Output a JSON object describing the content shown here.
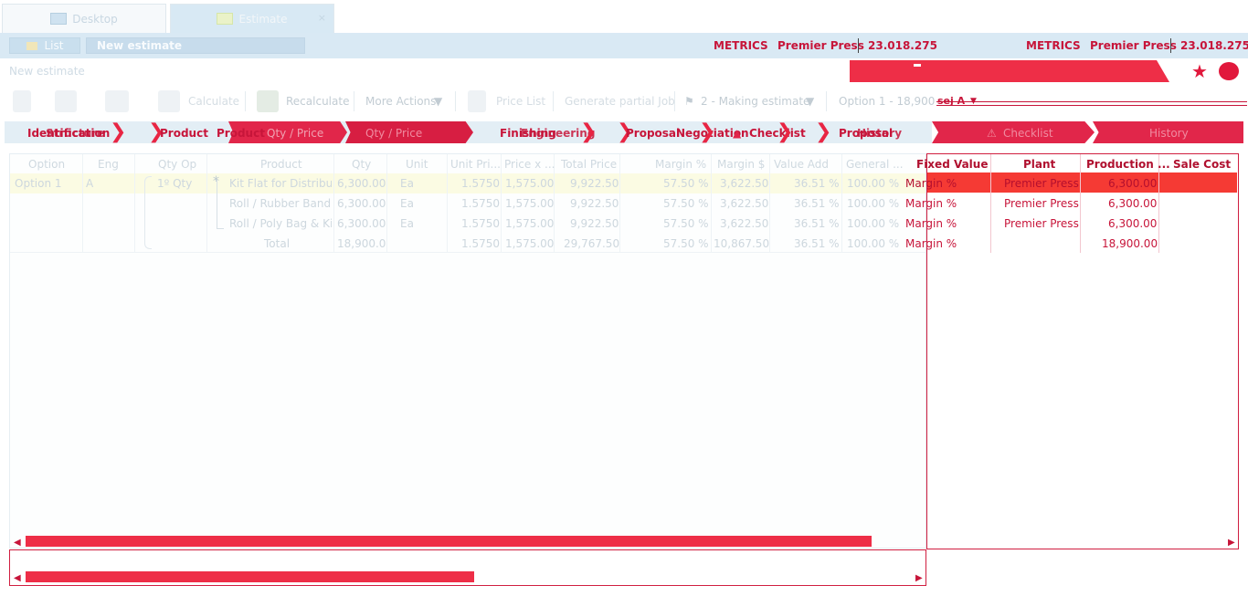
{
  "tabs": {
    "desktop": "Desktop",
    "estimate": "Estimate",
    "close": "×"
  },
  "header": {
    "list_button": "List",
    "title_value": "New estimate",
    "metrics_left": {
      "label": "METRICS",
      "company": "Premier Press",
      "id": "23.018.275"
    },
    "metrics_right": {
      "label": "METRICS",
      "company": "Premier Press",
      "id": "23.018.275"
    }
  },
  "breadcrumb": "New estimate",
  "toolbar": {
    "calculate": "Calculate",
    "recalculate": "Recalculate",
    "more_actions": "More Actions",
    "price_list": "Price List",
    "generate_partial_job": "Generate partial Job",
    "status": "2 - Making estimate",
    "option": "Option 1 - 18,900",
    "option_suffix": "sej A"
  },
  "steps": {
    "identification": "Identification",
    "structure": "Structure",
    "product1": "Product",
    "product2": "Product",
    "qty_price_overlay": "Qty / Price",
    "qty_price_active": "Qty / Price",
    "finishing": "Finishing",
    "engineering": "Engineering",
    "negotiation1": "Negotiation",
    "proposal1": "Proposal",
    "negotiation2": "Negotiation",
    "checklist1": "Checklist",
    "proposal2": "Proposal",
    "history1": "History",
    "checklist2": "Checklist",
    "history2": "History"
  },
  "grid": {
    "columns": [
      "Option",
      "Eng",
      "Qty Op",
      "Product",
      "Qty",
      "Unit",
      "Unit Pri...",
      "Price x ...",
      "Total Price",
      "Margin %",
      "Margin $",
      "Value Add",
      "General ...",
      "Fixed Value",
      "Plant",
      "Production ...",
      "Sale Cost"
    ],
    "rows": [
      {
        "option": "Option 1",
        "eng": "A",
        "qty_op": "1º Qty",
        "product": "Kit Flat for Distribut",
        "qty": "6,300.00",
        "unit": "Ea",
        "unit_price": "1.5750",
        "price_x": "1,575.00",
        "total": "9,922.50",
        "margin_pct": "57.50 %",
        "margin_usd": "3,622.50",
        "value_add": "36.51 %",
        "general": "100.00 %",
        "fixed": "Margin %",
        "plant": "Premier Press",
        "production": "6,300.00"
      },
      {
        "option": "",
        "eng": "",
        "qty_op": "",
        "product": "Roll / Rubber Band",
        "qty": "6,300.00",
        "unit": "Ea",
        "unit_price": "1.5750",
        "price_x": "1,575.00",
        "total": "9,922.50",
        "margin_pct": "57.50 %",
        "margin_usd": "3,622.50",
        "value_add": "36.51 %",
        "general": "100.00 %",
        "fixed": "Margin %",
        "plant": "Premier Press",
        "production": "6,300.00"
      },
      {
        "option": "",
        "eng": "",
        "qty_op": "",
        "product": "Roll / Poly Bag & Kit",
        "qty": "6,300.00",
        "unit": "Ea",
        "unit_price": "1.5750",
        "price_x": "1,575.00",
        "total": "9,922.50",
        "margin_pct": "57.50 %",
        "margin_usd": "3,622.50",
        "value_add": "36.51 %",
        "general": "100.00 %",
        "fixed": "Margin %",
        "plant": "Premier Press",
        "production": "6,300.00"
      },
      {
        "option": "",
        "eng": "",
        "qty_op": "",
        "product": "Total",
        "qty": "18,900.0",
        "unit": "",
        "unit_price": "1.5750",
        "price_x": "1,575.00",
        "total": "29,767.50",
        "margin_pct": "57.50 %",
        "margin_usd": "10,867.50",
        "value_add": "36.51 %",
        "general": "100.00 %",
        "fixed": "Margin %",
        "plant": "",
        "production": "18,900.00"
      }
    ]
  },
  "colors": {
    "accent": "#e1264a",
    "header_bg": "#d9e9f4",
    "highlight_row": "#fbfbe3"
  }
}
